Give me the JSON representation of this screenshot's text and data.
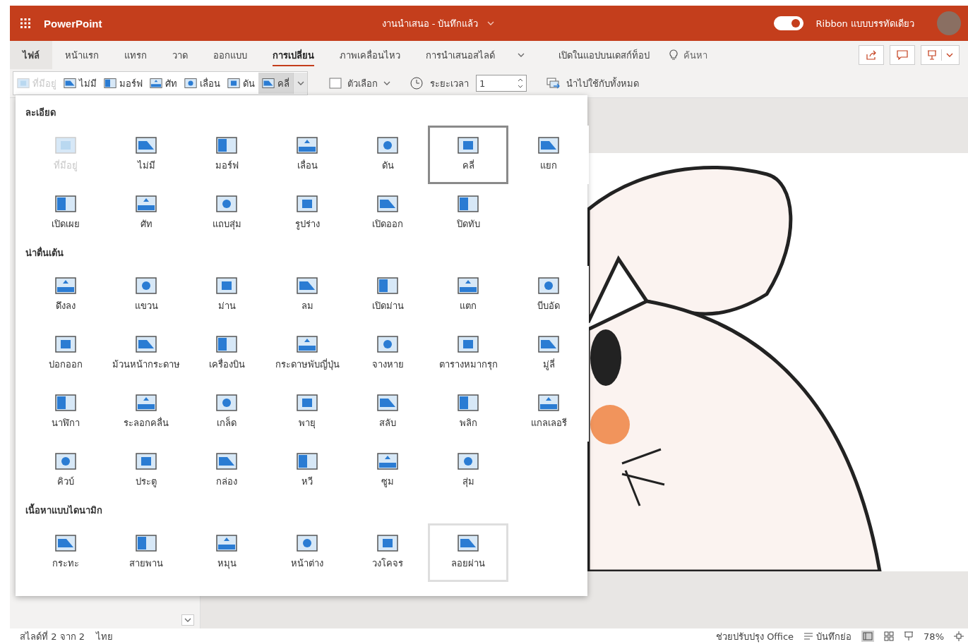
{
  "title_bar": {
    "app_name": "PowerPoint",
    "document_title": "งานนำเสนอ - บันทึกแล้ว",
    "ribbon_toggle": {
      "label": "Ribbon แบบบรรทัดเดียว",
      "on": true
    }
  },
  "tabs": [
    {
      "label": "ไฟล์",
      "selected": false,
      "kind": "file"
    },
    {
      "label": "หน้าแรก",
      "selected": false,
      "kind": "tab"
    },
    {
      "label": "แทรก",
      "selected": false,
      "kind": "tab"
    },
    {
      "label": "วาด",
      "selected": false,
      "kind": "tab"
    },
    {
      "label": "ออกแบบ",
      "selected": false,
      "kind": "tab"
    },
    {
      "label": "การเปลี่ยน",
      "selected": true,
      "kind": "tab"
    },
    {
      "label": "ภาพเคลื่อนไหว",
      "selected": false,
      "kind": "tab"
    },
    {
      "label": "การนำเสนอสไลด์",
      "selected": false,
      "kind": "tab"
    }
  ],
  "open_in_desktop": "เปิดในแอปบนเดสก์ท็อป",
  "search_label": "ค้นหา",
  "toolbar": {
    "transitions": [
      {
        "label": "ที่มีอยู่",
        "selected": false,
        "disabled": true
      },
      {
        "label": "ไม่มี",
        "selected": false,
        "disabled": false
      },
      {
        "label": "มอร์ฟ",
        "selected": false,
        "disabled": false
      },
      {
        "label": "ศัท",
        "selected": false,
        "disabled": false
      },
      {
        "label": "เลื่อน",
        "selected": false,
        "disabled": false
      },
      {
        "label": "ดัน",
        "selected": false,
        "disabled": false
      },
      {
        "label": "คลี่",
        "selected": true,
        "disabled": false
      }
    ],
    "effect_options": "ตัวเลือก",
    "duration": {
      "label": "ระยะเวลา",
      "value": "1"
    },
    "apply_all": "นำไปใช้กับทั้งหมด"
  },
  "gallery": {
    "sections": [
      {
        "title": "ละเอียด",
        "items": [
          {
            "label": "ที่มีอยู่",
            "selected": false,
            "disabled": true,
            "hovered": false
          },
          {
            "label": "ไม่มี",
            "selected": false,
            "disabled": false,
            "hovered": false
          },
          {
            "label": "มอร์ฟ",
            "selected": false,
            "disabled": false,
            "hovered": false
          },
          {
            "label": "เลื่อน",
            "selected": false,
            "disabled": false,
            "hovered": false
          },
          {
            "label": "ดัน",
            "selected": false,
            "disabled": false,
            "hovered": false
          },
          {
            "label": "คลี่",
            "selected": true,
            "disabled": false,
            "hovered": false
          },
          {
            "label": "แยก",
            "selected": false,
            "disabled": false,
            "hovered": false
          },
          {
            "label": "เปิดเผย",
            "selected": false,
            "disabled": false,
            "hovered": false
          },
          {
            "label": "ศัท",
            "selected": false,
            "disabled": false,
            "hovered": false
          },
          {
            "label": "แถบสุ่ม",
            "selected": false,
            "disabled": false,
            "hovered": false
          },
          {
            "label": "รูปร่าง",
            "selected": false,
            "disabled": false,
            "hovered": false
          },
          {
            "label": "เปิดออก",
            "selected": false,
            "disabled": false,
            "hovered": false
          },
          {
            "label": "ปิดทับ",
            "selected": false,
            "disabled": false,
            "hovered": false
          }
        ]
      },
      {
        "title": "น่าตื่นเต้น",
        "items": [
          {
            "label": "ดึงลง",
            "selected": false,
            "disabled": false,
            "hovered": false
          },
          {
            "label": "แขวน",
            "selected": false,
            "disabled": false,
            "hovered": false
          },
          {
            "label": "ม่าน",
            "selected": false,
            "disabled": false,
            "hovered": false
          },
          {
            "label": "ลม",
            "selected": false,
            "disabled": false,
            "hovered": false
          },
          {
            "label": "เปิดม่าน",
            "selected": false,
            "disabled": false,
            "hovered": false
          },
          {
            "label": "แตก",
            "selected": false,
            "disabled": false,
            "hovered": false
          },
          {
            "label": "บีบอัด",
            "selected": false,
            "disabled": false,
            "hovered": false
          },
          {
            "label": "ปอกออก",
            "selected": false,
            "disabled": false,
            "hovered": false
          },
          {
            "label": "ม้วนหน้ากระดาษ",
            "selected": false,
            "disabled": false,
            "hovered": false
          },
          {
            "label": "เครื่องบิน",
            "selected": false,
            "disabled": false,
            "hovered": false
          },
          {
            "label": "กระดาษพับญี่ปุ่น",
            "selected": false,
            "disabled": false,
            "hovered": false
          },
          {
            "label": "จางหาย",
            "selected": false,
            "disabled": false,
            "hovered": false
          },
          {
            "label": "ตารางหมากรุก",
            "selected": false,
            "disabled": false,
            "hovered": false
          },
          {
            "label": "มู่ลี่",
            "selected": false,
            "disabled": false,
            "hovered": false
          },
          {
            "label": "นาฬิกา",
            "selected": false,
            "disabled": false,
            "hovered": false
          },
          {
            "label": "ระลอกคลื่น",
            "selected": false,
            "disabled": false,
            "hovered": false
          },
          {
            "label": "เกล็ด",
            "selected": false,
            "disabled": false,
            "hovered": false
          },
          {
            "label": "พายุ",
            "selected": false,
            "disabled": false,
            "hovered": false
          },
          {
            "label": "สลับ",
            "selected": false,
            "disabled": false,
            "hovered": false
          },
          {
            "label": "พลิก",
            "selected": false,
            "disabled": false,
            "hovered": false
          },
          {
            "label": "แกลเลอรี",
            "selected": false,
            "disabled": false,
            "hovered": false
          },
          {
            "label": "คิวบ์",
            "selected": false,
            "disabled": false,
            "hovered": false
          },
          {
            "label": "ประตู",
            "selected": false,
            "disabled": false,
            "hovered": false
          },
          {
            "label": "กล่อง",
            "selected": false,
            "disabled": false,
            "hovered": false
          },
          {
            "label": "หวี",
            "selected": false,
            "disabled": false,
            "hovered": false
          },
          {
            "label": "ซูม",
            "selected": false,
            "disabled": false,
            "hovered": false
          },
          {
            "label": "สุ่ม",
            "selected": false,
            "disabled": false,
            "hovered": false
          }
        ]
      },
      {
        "title": "เนื้อหาแบบไดนามิก",
        "items": [
          {
            "label": "กระทะ",
            "selected": false,
            "disabled": false,
            "hovered": false
          },
          {
            "label": "สายพาน",
            "selected": false,
            "disabled": false,
            "hovered": false
          },
          {
            "label": "หมุน",
            "selected": false,
            "disabled": false,
            "hovered": false
          },
          {
            "label": "หน้าต่าง",
            "selected": false,
            "disabled": false,
            "hovered": false
          },
          {
            "label": "วงโคจร",
            "selected": false,
            "disabled": false,
            "hovered": false
          },
          {
            "label": "ลอยผ่าน",
            "selected": false,
            "disabled": false,
            "hovered": true
          }
        ]
      }
    ]
  },
  "status_bar": {
    "slide_info": "สไลด์ที่ 2 จาก 2",
    "language": "ไทย",
    "feedback": "ช่วยปรับปรุง Office",
    "notes": "บันทึกย่อ",
    "zoom": "78%"
  }
}
